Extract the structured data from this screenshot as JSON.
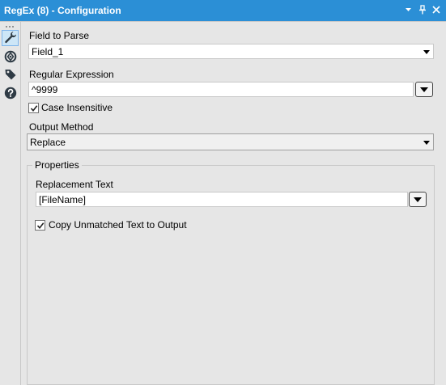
{
  "window": {
    "title": "RegEx (8) - Configuration",
    "controls": [
      "pin-dropdown",
      "pin",
      "close"
    ]
  },
  "sidebar": {
    "items": [
      {
        "name": "configuration",
        "icon": "wrench-icon",
        "active": true
      },
      {
        "name": "layout",
        "icon": "target-icon",
        "active": false
      },
      {
        "name": "annotation",
        "icon": "tag-icon",
        "active": false
      },
      {
        "name": "help",
        "icon": "help-icon",
        "active": false
      }
    ]
  },
  "form": {
    "field_to_parse_label": "Field to Parse",
    "field_to_parse_value": "Field_1",
    "regex_label": "Regular Expression",
    "regex_value": "^9999",
    "case_insensitive_label": "Case Insensitive",
    "case_insensitive_checked": true,
    "output_method_label": "Output Method",
    "output_method_value": "Replace"
  },
  "properties": {
    "group_label": "Properties",
    "replacement_text_label": "Replacement Text",
    "replacement_text_value": "[FileName]",
    "copy_unmatched_label": "Copy Unmatched Text to Output",
    "copy_unmatched_checked": true
  },
  "colors": {
    "titlebar": "#2b8fd6",
    "background": "#e6e6e6",
    "active_tab": "#cde6f7"
  }
}
